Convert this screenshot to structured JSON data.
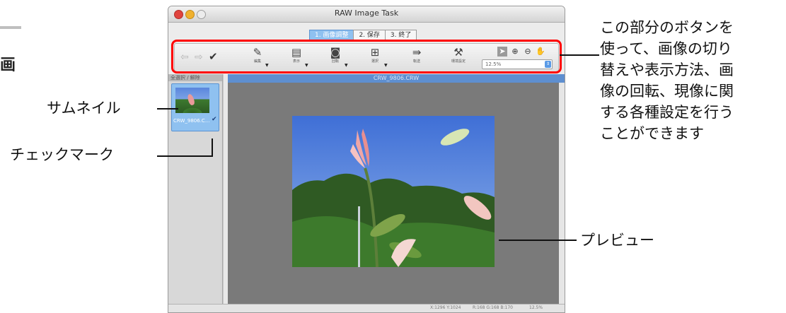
{
  "side_char": "画",
  "window": {
    "title": "RAW Image Task",
    "steps": [
      "1. 画像調整",
      "2. 保存",
      "3. 終了"
    ]
  },
  "toolbar": {
    "buttons": [
      {
        "label": "編集",
        "icon": "edit-icon"
      },
      {
        "label": "表示",
        "icon": "display-icon"
      },
      {
        "label": "回転",
        "icon": "rotate-icon"
      },
      {
        "label": "選択",
        "icon": "select-icon"
      },
      {
        "label": "転送",
        "icon": "transfer-icon"
      },
      {
        "label": "環境設定",
        "icon": "preferences-icon"
      }
    ],
    "zoom_value": "12.5%",
    "tool_icons": [
      "pointer-icon",
      "zoom-in-icon",
      "zoom-out-icon",
      "hand-icon"
    ]
  },
  "thumbnail_panel": {
    "header": "全選択 / 解除",
    "filename": "CRW_9806.C..."
  },
  "preview": {
    "filename": "CRW_9806.CRW"
  },
  "status_bar": {
    "coords": "X:1296 Y:1024",
    "rgb": "R:168 G:168 B:170",
    "zoom": "12.5%"
  },
  "annotations": {
    "toolbar_note": [
      "この部分のボタンを",
      "使って、画像の切り",
      "替えや表示方法、画",
      "像の回転、現像に関",
      "する各種設定を行う",
      "ことができます"
    ],
    "thumbnail": "サムネイル",
    "checkmark": "チェックマーク",
    "preview": "プレビュー"
  },
  "colors": {
    "highlight": "#ff0000",
    "selection": "#8fc1f0",
    "preview_background": "#7a7a7a"
  }
}
